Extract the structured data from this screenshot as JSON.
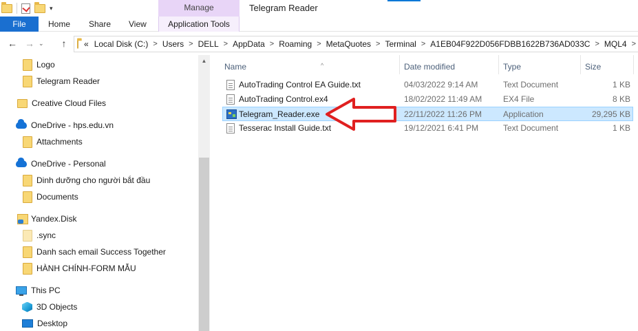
{
  "titlebar": {
    "manage_label": "Manage",
    "window_title": "Telegram Reader"
  },
  "ribbon": {
    "tabs": [
      "File",
      "Home",
      "Share",
      "View",
      "Application Tools"
    ]
  },
  "address": {
    "overflow": "«",
    "crumbs": [
      "Local Disk (C:)",
      "Users",
      "DELL",
      "AppData",
      "Roaming",
      "MetaQuotes",
      "Terminal",
      "A1EB04F922D056FDBB1622B736AD033C",
      "MQL4"
    ]
  },
  "nav": {
    "items": [
      {
        "label": "Logo",
        "icon": "folder-icon"
      },
      {
        "label": "Telegram Reader",
        "icon": "folder-icon"
      },
      {
        "label": "Creative Cloud Files",
        "icon": "creative-cloud-folder-icon"
      },
      {
        "label": "OneDrive - hps.edu.vn",
        "icon": "onedrive-icon"
      },
      {
        "label": "Attachments",
        "icon": "folder-icon"
      },
      {
        "label": "OneDrive - Personal",
        "icon": "onedrive-icon"
      },
      {
        "label": "Dinh dưỡng cho người bắt đầu",
        "icon": "folder-icon"
      },
      {
        "label": "Documents",
        "icon": "folder-icon"
      },
      {
        "label": "Yandex.Disk",
        "icon": "yandex-disk-icon"
      },
      {
        "label": ".sync",
        "icon": "folder-icon"
      },
      {
        "label": "Danh sach email Success Together",
        "icon": "folder-icon"
      },
      {
        "label": "HÀNH CHÍNH-FORM MẪU",
        "icon": "folder-icon"
      },
      {
        "label": "This PC",
        "icon": "pc-icon"
      },
      {
        "label": "3D Objects",
        "icon": "3d-objects-icon"
      },
      {
        "label": "Desktop",
        "icon": "desktop-icon"
      }
    ]
  },
  "columns": {
    "name": "Name",
    "date": "Date modified",
    "type": "Type",
    "size": "Size"
  },
  "files": [
    {
      "name": "AutoTrading Control EA Guide.txt",
      "date": "04/03/2022 9:14 AM",
      "type": "Text Document",
      "size": "1 KB",
      "icon": "text-file-icon"
    },
    {
      "name": "AutoTrading Control.ex4",
      "date": "18/02/2022 11:49 AM",
      "type": "EX4 File",
      "size": "8 KB",
      "icon": "text-file-icon"
    },
    {
      "name": "Telegram_Reader.exe",
      "date": "22/11/2022 11:26 PM",
      "type": "Application",
      "size": "29,295 KB",
      "icon": "application-icon",
      "selected": true
    },
    {
      "name": "Tesserac Install Guide.txt",
      "date": "19/12/2021 6:41 PM",
      "type": "Text Document",
      "size": "1 KB",
      "icon": "text-file-icon"
    }
  ],
  "colors": {
    "file_tab": "#1a6fd0",
    "manage_tab": "#e8d5f7",
    "selection": "#cce8ff",
    "annotation_arrow": "#e02020"
  }
}
